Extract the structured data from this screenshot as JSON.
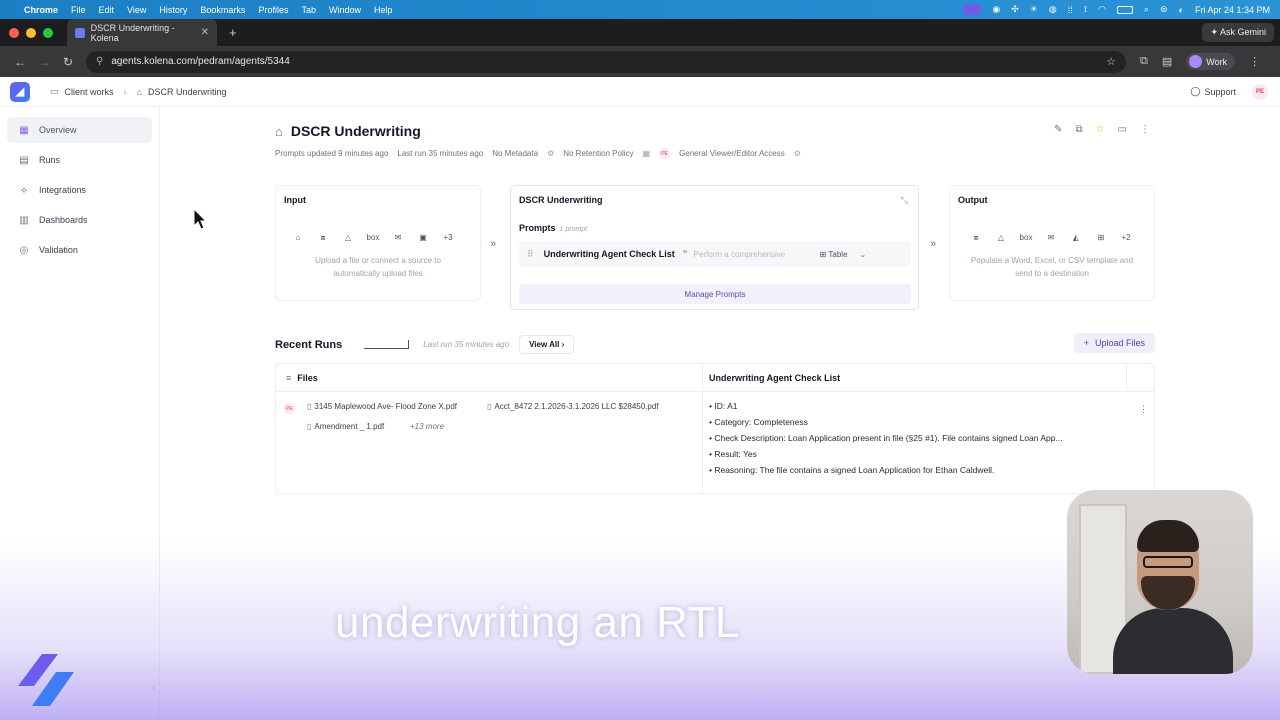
{
  "menubar": {
    "app": "Chrome",
    "items": [
      "File",
      "Edit",
      "View",
      "History",
      "Bookmarks",
      "Profiles",
      "Tab",
      "Window",
      "Help"
    ],
    "datetime": "Fri Apr 24  1:34 PM"
  },
  "browser": {
    "tab_title": "DSCR Underwriting - Kolena",
    "url": "agents.kolena.com/pedram/agents/5344",
    "ask_gemini": "Ask Gemini",
    "profile": "Work"
  },
  "header": {
    "breadcrumb": [
      "Client works",
      "DSCR Underwriting"
    ],
    "support": "Support",
    "user_initials": "PE"
  },
  "sidebar": {
    "items": [
      {
        "label": "Overview",
        "icon": "grid-icon"
      },
      {
        "label": "Runs",
        "icon": "file-icon"
      },
      {
        "label": "Integrations",
        "icon": "integrations-icon"
      },
      {
        "label": "Dashboards",
        "icon": "chart-icon"
      },
      {
        "label": "Validation",
        "icon": "target-icon"
      }
    ]
  },
  "agent": {
    "title": "DSCR Underwriting",
    "prompts_updated": "Prompts updated 9 minutes ago",
    "last_run": "Last run 35 minutes ago",
    "metadata": "No Metadata",
    "retention": "No Retention Policy",
    "access_initials": "PE",
    "access": "General Viewer/Editor Access"
  },
  "input_card": {
    "title": "Input",
    "more": "+3",
    "box": "box",
    "hint": "Upload a file or connect a source to automatically upload files"
  },
  "prompts_card": {
    "title": "DSCR Underwriting",
    "label": "Prompts",
    "count": "1 prompt",
    "prompt_name": "Underwriting Agent Check List",
    "prompt_desc": "Perform a comprehensive",
    "prompt_type": "Table",
    "manage": "Manage Prompts"
  },
  "output_card": {
    "title": "Output",
    "more": "+2",
    "box": "box",
    "hint": "Populate a Word, Excel, or CSV template and send to a destination"
  },
  "recent_runs": {
    "title": "Recent Runs",
    "last_run": "Last run 35 minutes ago",
    "view_all": "View All",
    "upload": "Upload Files",
    "col_files": "Files",
    "col_check": "Underwriting Agent Check List",
    "row_initials": "PE",
    "files": [
      "3145 Maplewood Ave- Flood Zone X.pdf",
      "Acct_8472 2.1.2026-3.1.2026 LLC $28450.pdf",
      "Amendment _ 1.pdf"
    ],
    "more_files": "+13 more",
    "check_lines": [
      "ID: A1",
      "Category: Completeness",
      "Check Description: Loan Application present in file (§25 #1). File contains signed Loan App...",
      "Result: Yes",
      "Reasoning: The file contains a signed Loan Application for Ethan Caldwell."
    ]
  },
  "caption": "underwriting an RTL",
  "colors": {
    "accent": "#6b5cf0",
    "menubar": "#1b7fc4",
    "badge": "#e0446a"
  }
}
